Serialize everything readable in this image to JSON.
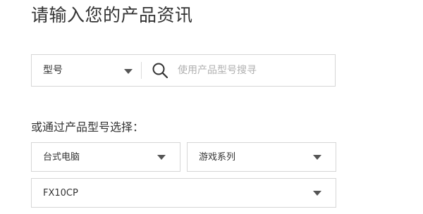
{
  "header": {
    "title": "请输入您的产品资讯"
  },
  "search": {
    "type_select_label": "型号",
    "placeholder": "使用产品型号搜寻",
    "value": ""
  },
  "browse": {
    "label": "或通过产品型号选择：",
    "category_value": "台式电脑",
    "series_value": "游戏系列",
    "model_value": "FX10CP"
  },
  "icons": {
    "search": "search-icon",
    "caret": "caret-down-icon"
  }
}
